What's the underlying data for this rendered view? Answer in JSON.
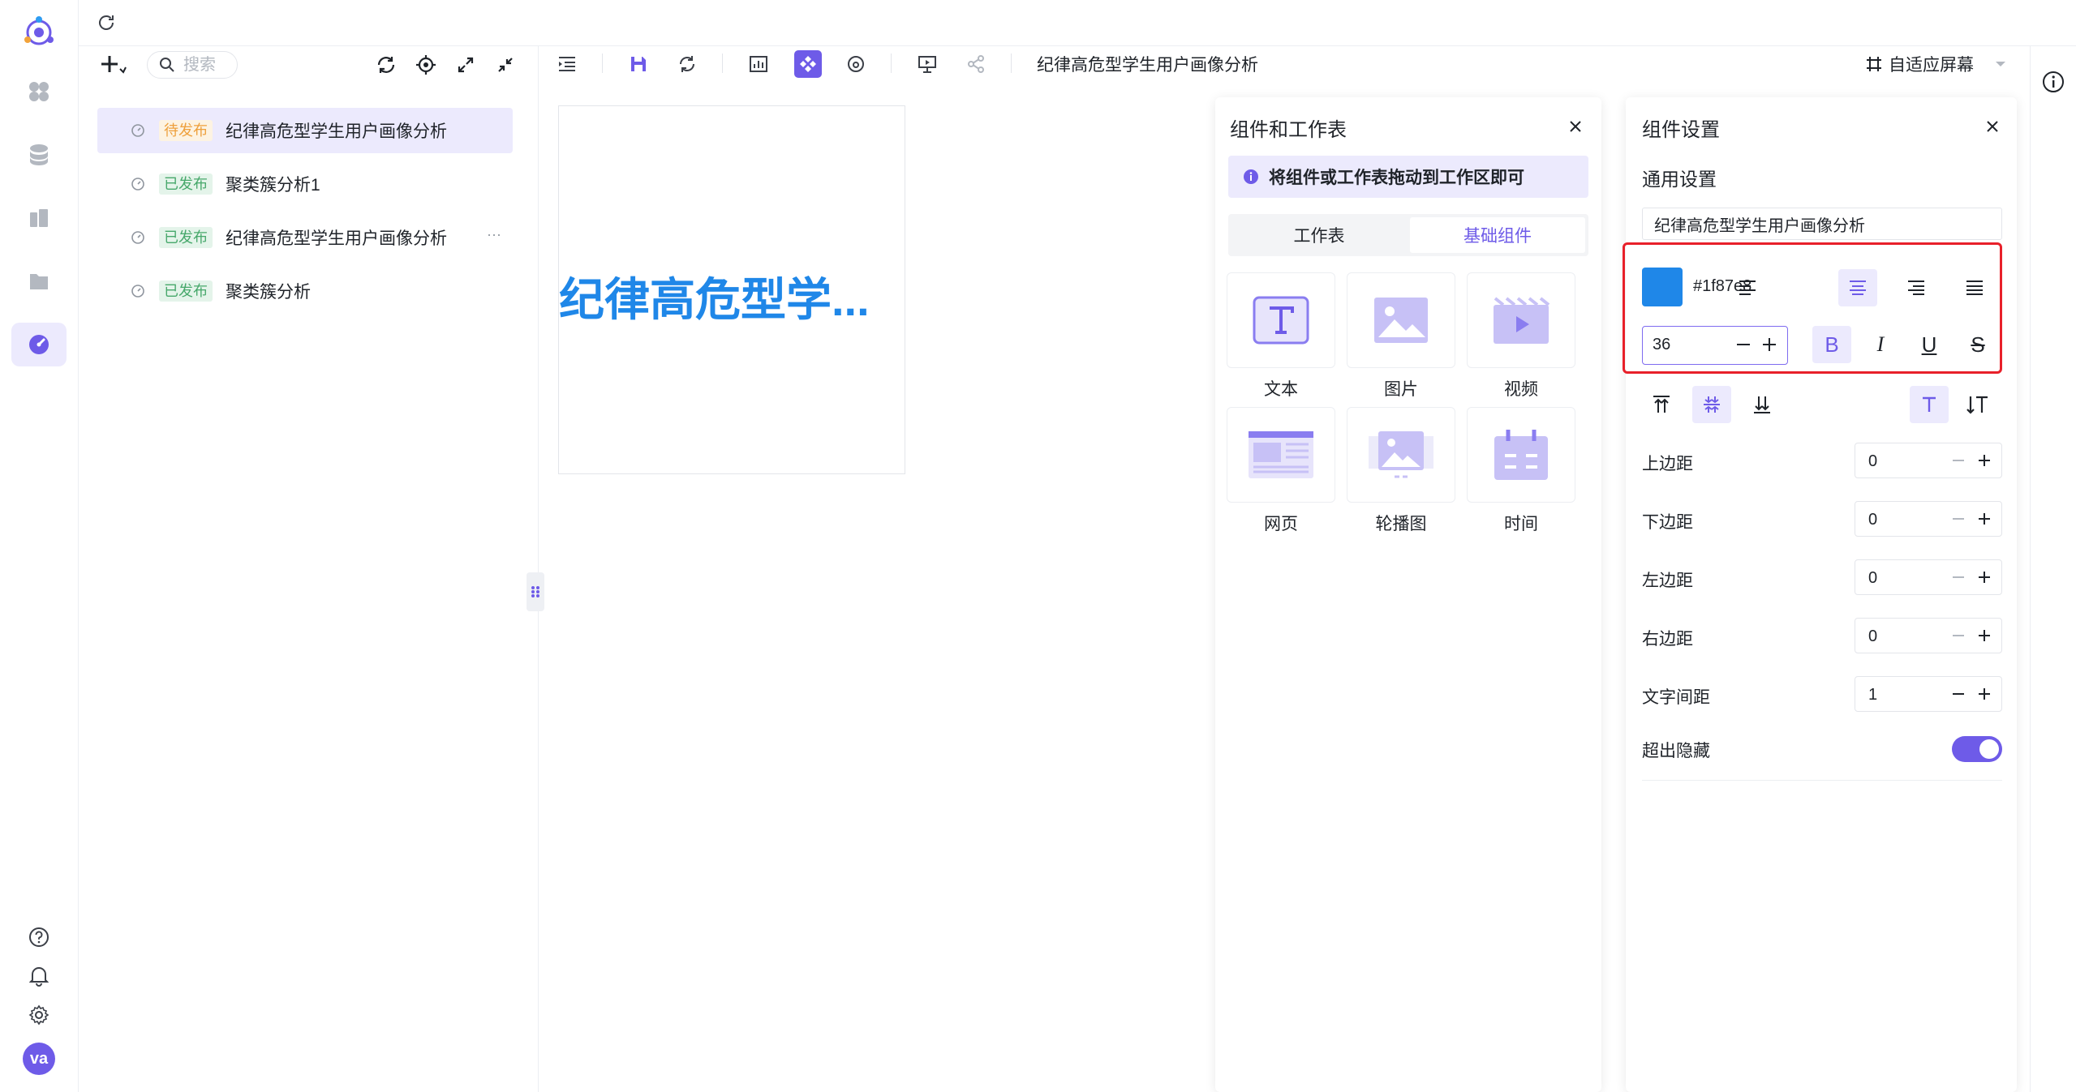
{
  "sidebar_tree": {
    "search_placeholder": "搜索",
    "items": [
      {
        "status": "待发布",
        "label": "纪律高危型学生用户画像分析",
        "active": true
      },
      {
        "status": "已发布",
        "label": "聚类簇分析1"
      },
      {
        "status": "已发布",
        "label": "纪律高危型学生用户画像分析",
        "more": "···"
      },
      {
        "status": "已发布",
        "label": "聚类簇分析"
      }
    ]
  },
  "toolbar": {
    "doc_title": "纪律高危型学生用户画像分析",
    "fit_screen_label": "自适应屏幕"
  },
  "canvas": {
    "text": "纪律高危型学...",
    "text_color": "#1f87e8"
  },
  "components_panel": {
    "title": "组件和工作表",
    "tip": "将组件或工作表拖动到工作区即可",
    "tabs": [
      "工作表",
      "基础组件"
    ],
    "active_tab": "基础组件",
    "items": [
      {
        "label": "文本",
        "icon": "text-icon"
      },
      {
        "label": "图片",
        "icon": "image-icon"
      },
      {
        "label": "视频",
        "icon": "video-icon"
      },
      {
        "label": "网页",
        "icon": "webpage-icon"
      },
      {
        "label": "轮播图",
        "icon": "carousel-icon"
      },
      {
        "label": "时间",
        "icon": "calendar-icon"
      }
    ]
  },
  "settings_panel": {
    "title": "组件设置",
    "section": "通用设置",
    "title_value": "纪律高危型学生用户画像分析",
    "color_hex": "#1f87e8",
    "font_size": "36",
    "bold_symbol": "B",
    "italic_symbol": "I",
    "underline_symbol": "U",
    "strike_symbol": "S",
    "fields": [
      {
        "label": "上边距",
        "value": "0"
      },
      {
        "label": "下边距",
        "value": "0"
      },
      {
        "label": "左边距",
        "value": "0"
      },
      {
        "label": "右边距",
        "value": "0"
      },
      {
        "label": "文字间距",
        "value": "1"
      }
    ],
    "overflow_label": "超出隐藏",
    "overflow_on": true
  },
  "colors": {
    "accent": "#6e5be8",
    "accent_light": "#eceafd",
    "highlight_box": "#e8202a"
  }
}
